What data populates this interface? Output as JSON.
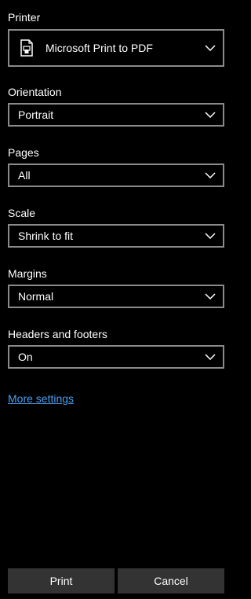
{
  "printer": {
    "label": "Printer",
    "value": "Microsoft Print to PDF",
    "icon": "printer-document-icon"
  },
  "orientation": {
    "label": "Orientation",
    "value": "Portrait"
  },
  "pages": {
    "label": "Pages",
    "value": "All"
  },
  "scale": {
    "label": "Scale",
    "value": "Shrink to fit"
  },
  "margins": {
    "label": "Margins",
    "value": "Normal"
  },
  "headers_footers": {
    "label": "Headers and footers",
    "value": "On"
  },
  "more_settings": "More settings",
  "actions": {
    "print": "Print",
    "cancel": "Cancel"
  },
  "colors": {
    "background": "#000000",
    "field_border": "#8a8a8a",
    "link": "#4a9ff0",
    "button_bg": "#333333"
  }
}
